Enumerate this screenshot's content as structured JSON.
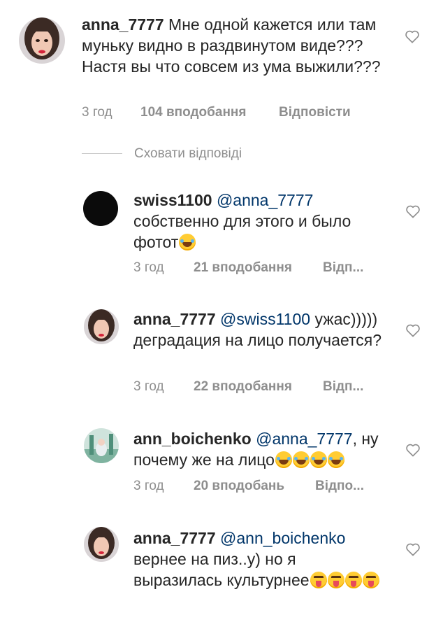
{
  "comments": [
    {
      "username": "anna_7777",
      "mention": "",
      "text": "Мне одной кажется или там муньку видно в раздвинутом виде??? Настя вы что совсем из ума выжили???",
      "time": "3 год",
      "likes": "104 вподобання",
      "reply": "Відповісти"
    },
    {
      "username": "swiss1100",
      "mention": "@anna_7777",
      "text": "собственно для этого и было фотот",
      "time": "3 год",
      "likes": "21 вподобання",
      "reply": "Відп..."
    },
    {
      "username": "anna_7777",
      "mention": "@swiss1100",
      "text": "ужас))))) деградация на лицо получается?",
      "time": "3 год",
      "likes": "22 вподобання",
      "reply": "Відп..."
    },
    {
      "username": "ann_boichenko",
      "mention": "@anna_7777",
      "text": ", ну почему же на лицо",
      "time": "3 год",
      "likes": "20 вподобань",
      "reply": "Відпо..."
    },
    {
      "username": "anna_7777",
      "mention": "@ann_boichenko",
      "text": "вернее на пиз..у) но я выразилась культурнее",
      "time": "",
      "likes": "",
      "reply": ""
    }
  ],
  "hide_replies": "Сховати відповіді",
  "icons": {
    "heart": "heart-outline-icon",
    "emoji_laugh": "face-with-tears-of-joy-emoji",
    "emoji_tongue": "squinting-face-with-tongue-emoji"
  },
  "colors": {
    "text": "#262626",
    "mention": "#003569",
    "meta": "#8e8e8e"
  }
}
